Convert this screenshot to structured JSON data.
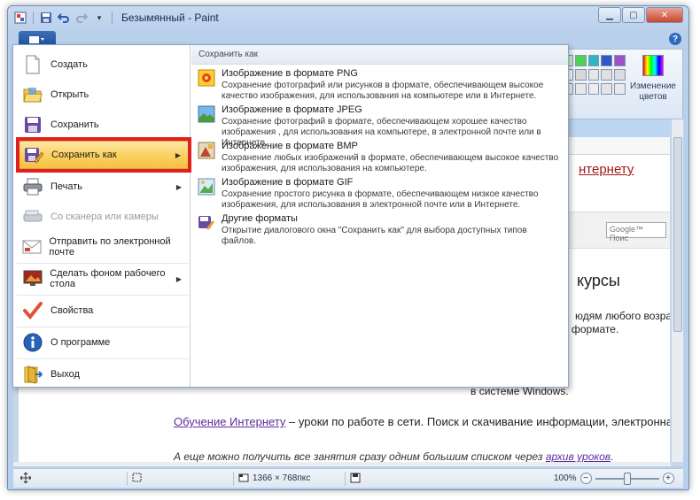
{
  "window": {
    "title": "Безымянный - Paint"
  },
  "ribbon": {
    "help": "?",
    "edit_colors_label": "Изменение цветов",
    "palette": [
      [
        "#c8fac8",
        "#50d050",
        "#2fb5c8",
        "#3258c8",
        "#a050c8"
      ],
      [
        "#ffffff",
        "#d8d8d8",
        "#e6e6e6",
        "#e0e0e0",
        "#dcdcdc"
      ],
      [
        "#f0f0f0",
        "#e8e8e8",
        "#ececec",
        "#e4e4e4",
        "#e9e9e9"
      ]
    ]
  },
  "app_menu": {
    "items": [
      {
        "label": "Создать",
        "icon": "new-document-icon"
      },
      {
        "label": "Открыть",
        "icon": "open-folder-icon"
      },
      {
        "label": "Сохранить",
        "icon": "save-disk-icon"
      },
      {
        "label": "Сохранить как",
        "icon": "save-as-icon",
        "arrow": "▶"
      },
      {
        "label": "Печать",
        "icon": "printer-icon",
        "arrow": "▶"
      },
      {
        "label": "Со сканера или камеры",
        "icon": "scanner-icon"
      },
      {
        "label": "Отправить по электронной почте",
        "icon": "email-icon"
      },
      {
        "label": "Сделать фоном рабочего стола",
        "icon": "desktop-background-icon",
        "arrow": "▶"
      },
      {
        "label": "Свойства",
        "icon": "checkmark-icon"
      },
      {
        "label": "О программе",
        "icon": "info-icon"
      },
      {
        "label": "Выход",
        "icon": "exit-icon"
      }
    ],
    "submenu": {
      "header": "Сохранить как",
      "items": [
        {
          "title": "Изображение в формате PNG",
          "desc": "Сохранение фотографий или рисунков в формате, обеспечивающем высокое качество изображения, для использования на компьютере или в Интернете."
        },
        {
          "title": "Изображение в формате JPEG",
          "desc": "Сохранение фотографий в формате, обеспечивающем хорошее качество изображения , для использования на компьютере, в электронной почте или в Интернете."
        },
        {
          "title": "Изображение в формате BMP",
          "desc": "Сохранение любых изображений в формате, обеспечивающем высокое качество изображения, для использования на компьютере."
        },
        {
          "title": "Изображение в формате GIF",
          "desc": "Сохранение простого рисунка в формате, обеспечивающем низкое качество изображения, для использования в электронной почте или в Интернете."
        },
        {
          "title": "Другие форматы",
          "desc": "Открытие диалогового окна \"Сохранить как\" для выбора доступных типов файлов."
        }
      ]
    }
  },
  "canvas_content": {
    "link_top": "нтернету",
    "google_placeholder": "Google™ Поис",
    "heading": "курсы",
    "text_1": "юдям любого возраст",
    "text_2": "формате.",
    "text_3": "в системе Windows.",
    "link_bottom": "Обучение Интернету",
    "text_bottom": " – уроки по работе в сети. Поиск и скачивание информации, электронная",
    "italic_text": "А еще можно получить все занятия сразу одним большим списком через ",
    "italic_link": "архив уроков",
    "italic_end": "."
  },
  "statusbar": {
    "dimensions": "1366 × 768пкс",
    "zoom": "100%",
    "zoom_minus": "−",
    "zoom_plus": "+",
    "zoom_level": 0.5
  }
}
